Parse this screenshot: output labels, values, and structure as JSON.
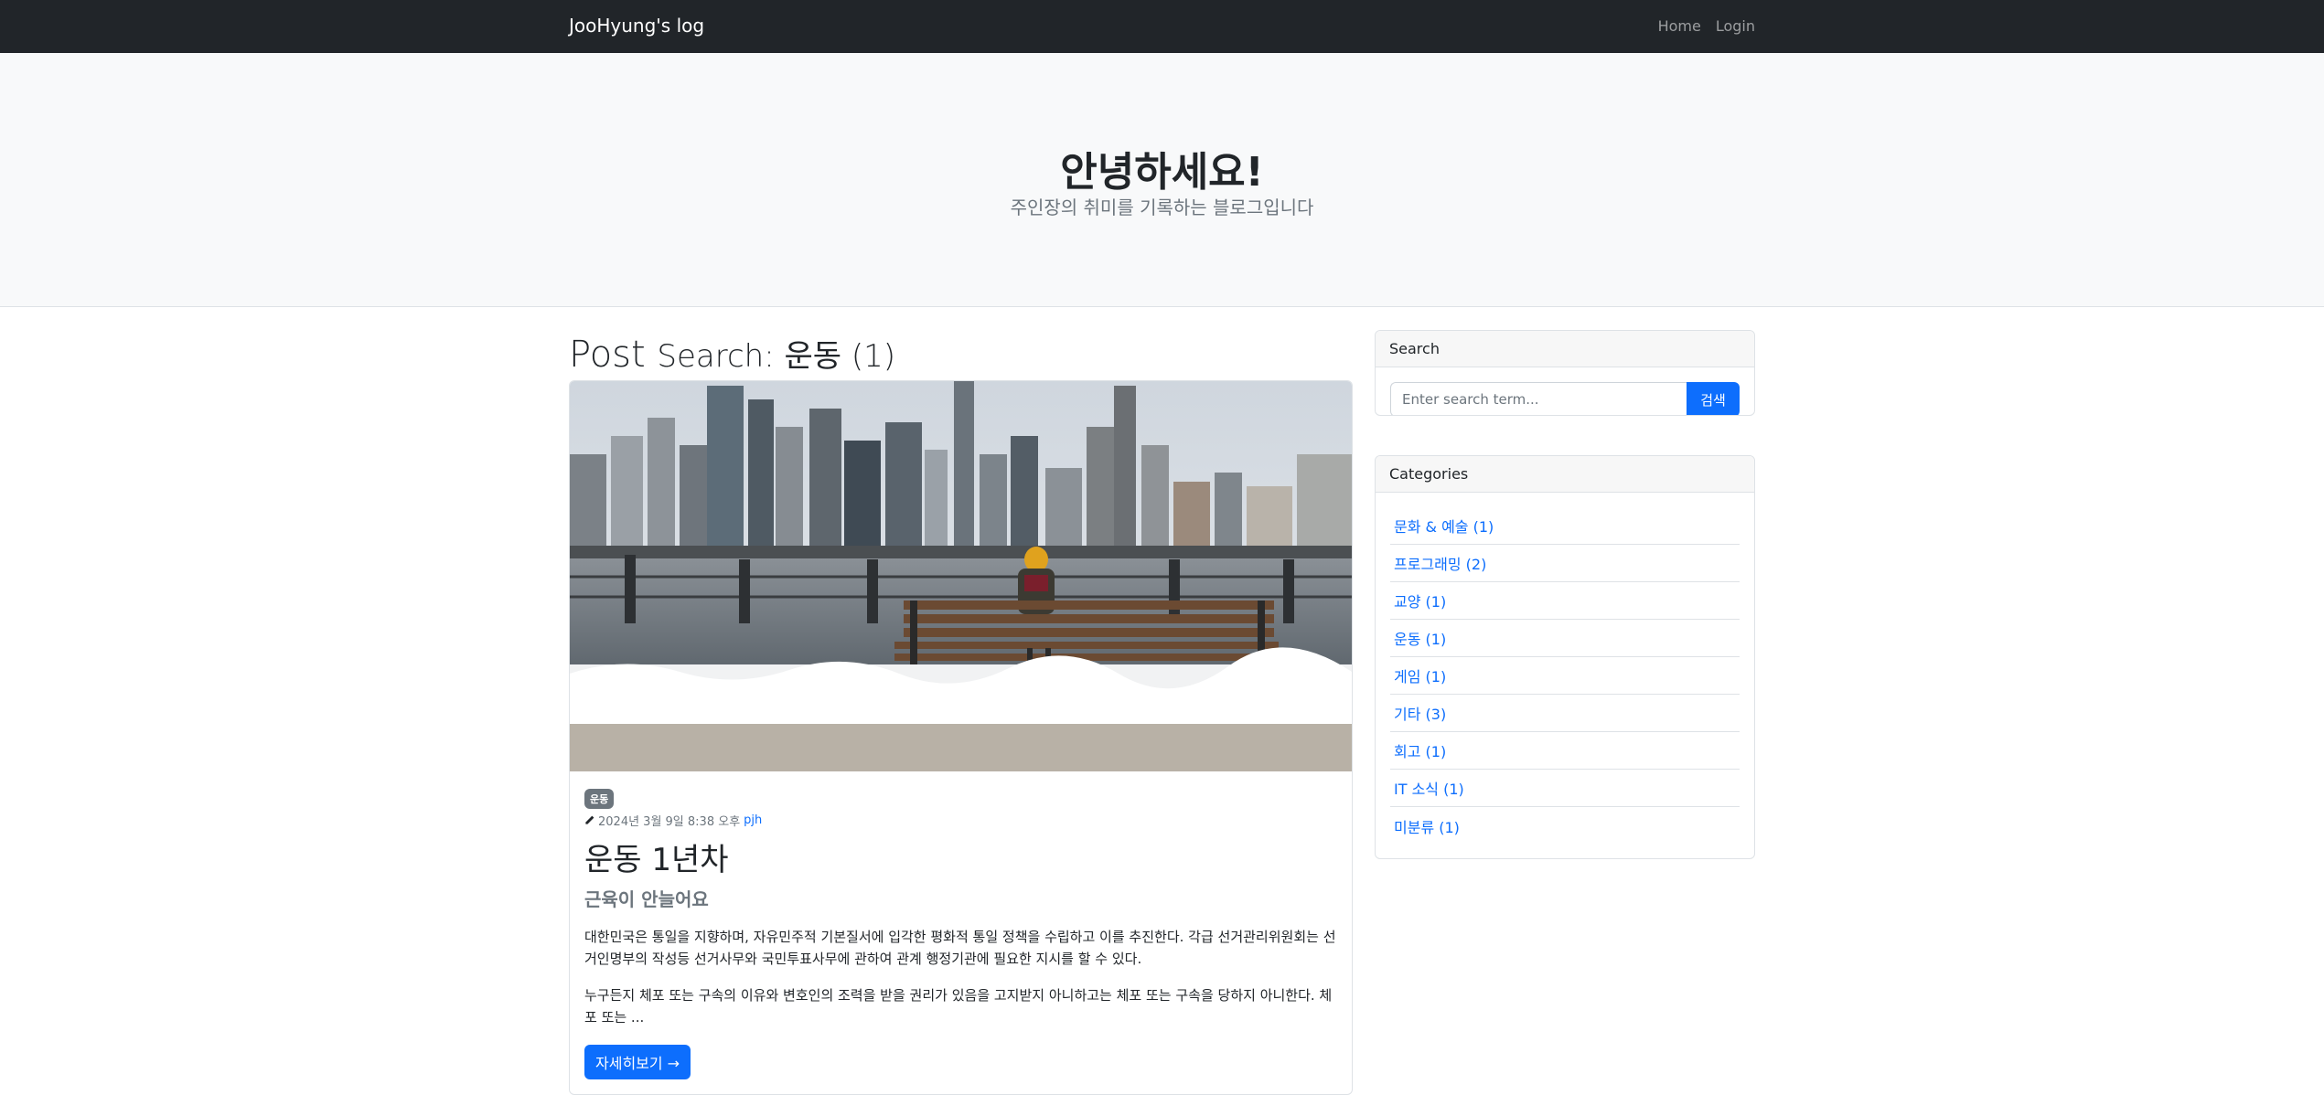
{
  "navbar": {
    "brand": "JooHyung's log",
    "links": [
      {
        "label": "Home"
      },
      {
        "label": "Login"
      }
    ]
  },
  "hero": {
    "title": "안녕하세요!",
    "subtitle": "주인장의 취미를 기록하는 블로그입니다"
  },
  "main": {
    "heading": "Post",
    "heading_small": "Search: 운동 (1)",
    "post": {
      "category_badge": "운동",
      "date": "2024년 3월 9일 8:38 오후",
      "author": "pjh",
      "title": "운동 1년차",
      "subtitle": "근육이 안늘어요",
      "paragraphs": [
        "대한민국은 통일을 지향하며, 자유민주적 기본질서에 입각한 평화적 통일 정책을 수립하고 이를 추진한다. 각급 선거관리위원회는 선거인명부의 작성등 선거사무와 국민투표사무에 관하여 관계 행정기관에 필요한 지시를 할 수 있다.",
        "누구든지 체포 또는 구속의 이유와 변호인의 조력을 받을 권리가 있음을 고지받지 아니하고는 체포 또는 구속을 당하지 아니한다. 체포 또는 ..."
      ],
      "read_more": "자세히보기 →"
    }
  },
  "sidebar": {
    "search": {
      "header": "Search",
      "placeholder": "Enter search term...",
      "button": "검색"
    },
    "categories": {
      "header": "Categories",
      "items": [
        {
          "label": "문화 & 예술 (1)"
        },
        {
          "label": "프로그래밍 (2)"
        },
        {
          "label": "교양 (1)"
        },
        {
          "label": "운동 (1)"
        },
        {
          "label": "게임 (1)"
        },
        {
          "label": "기타 (3)"
        },
        {
          "label": "회고 (1)"
        },
        {
          "label": "IT 소식 (1)"
        },
        {
          "label": "미분류 (1)"
        }
      ]
    }
  },
  "colors": {
    "navbar_bg": "#212529",
    "hero_bg": "#f8f9fa",
    "primary": "#0d6efd",
    "badge_bg": "#6c757d"
  }
}
